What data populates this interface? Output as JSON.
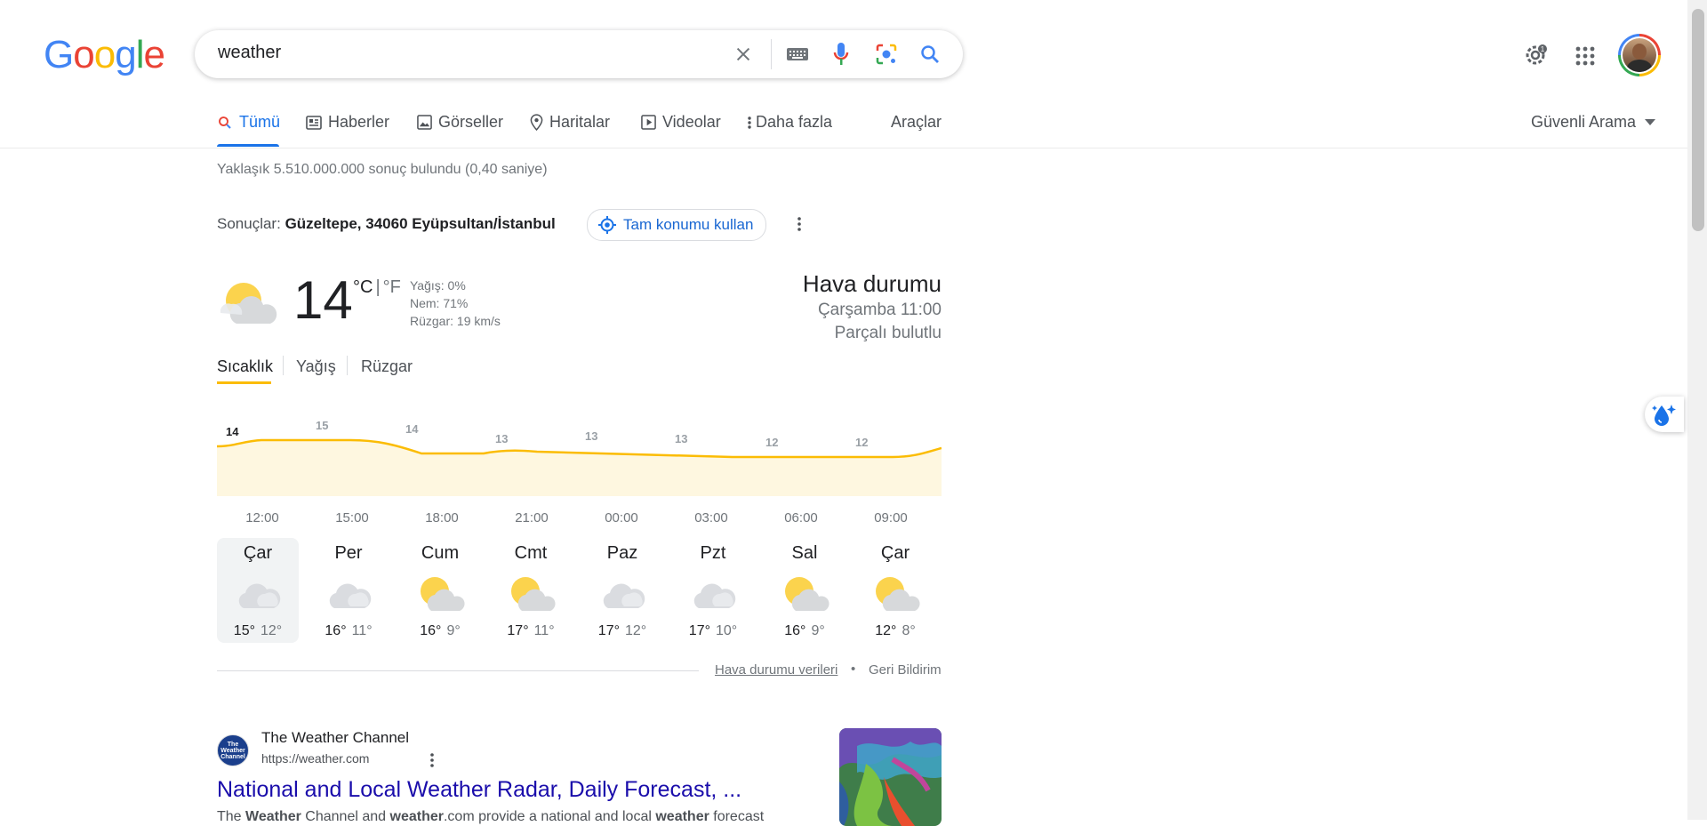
{
  "search": {
    "query": "weather"
  },
  "logo_text": "Google",
  "tabs": [
    {
      "label": "Tümü",
      "icon": "search-icon",
      "active": true
    },
    {
      "label": "Haberler",
      "icon": "news-icon"
    },
    {
      "label": "Görseller",
      "icon": "images-icon"
    },
    {
      "label": "Haritalar",
      "icon": "map-pin-icon"
    },
    {
      "label": "Videolar",
      "icon": "video-icon"
    },
    {
      "label": "Daha fazla",
      "icon": "more-vert-icon"
    },
    {
      "label": "Araçlar"
    }
  ],
  "safe_search": "Güvenli Arama",
  "result_stats": "Yaklaşık 5.510.000.000 sonuç bulundu (0,40 saniye)",
  "location": {
    "prefix": "Sonuçlar:",
    "place": "Güzeltepe, 34060 Eyüpsultan/İstanbul",
    "button": "Tam konumu kullan"
  },
  "weather": {
    "temp": "14",
    "unit_c": "°C",
    "unit_f": "°F",
    "precip": "Yağış: 0%",
    "humidity": "Nem: 71%",
    "wind": "Rüzgar: 19 km/s",
    "title": "Hava durumu",
    "time": "Çarşamba 11:00",
    "condition": "Parçalı bulutlu",
    "tabs": [
      "Sıcaklık",
      "Yağış",
      "Rüzgar"
    ],
    "hours": [
      "12:00",
      "15:00",
      "18:00",
      "21:00",
      "00:00",
      "03:00",
      "06:00",
      "09:00"
    ],
    "hour_temps": [
      "14",
      "15",
      "14",
      "13",
      "13",
      "13",
      "12",
      "12"
    ],
    "days": [
      {
        "name": "Çar",
        "hi": "15°",
        "lo": "12°",
        "icon": "cloudy-icon"
      },
      {
        "name": "Per",
        "hi": "16°",
        "lo": "11°",
        "icon": "cloudy-icon"
      },
      {
        "name": "Cum",
        "hi": "16°",
        "lo": "9°",
        "icon": "partly-cloudy-icon"
      },
      {
        "name": "Cmt",
        "hi": "17°",
        "lo": "11°",
        "icon": "partly-cloudy-icon"
      },
      {
        "name": "Paz",
        "hi": "17°",
        "lo": "12°",
        "icon": "cloudy-icon"
      },
      {
        "name": "Pzt",
        "hi": "17°",
        "lo": "10°",
        "icon": "cloudy-icon"
      },
      {
        "name": "Sal",
        "hi": "16°",
        "lo": "9°",
        "icon": "partly-cloudy-icon"
      },
      {
        "name": "Çar",
        "hi": "12°",
        "lo": "8°",
        "icon": "partly-cloudy-icon"
      }
    ],
    "footer_link": "Hava durumu verileri",
    "footer_sep": "•",
    "feedback": "Geri Bildirim"
  },
  "result": {
    "site": "The Weather Channel",
    "url": "https://weather.com",
    "title": "National and Local Weather Radar, Daily Forecast, ...",
    "snippet_html": "The <b>Weather</b> Channel and <b>weather</b>.com provide a national and local <b>weather</b> forecast",
    "snippet": "The Weather Channel and weather.com provide a national and local weather forecast"
  },
  "colors": {
    "accent": "#1a73e8",
    "link": "#1a0dab",
    "sun": "#fbbc04"
  }
}
